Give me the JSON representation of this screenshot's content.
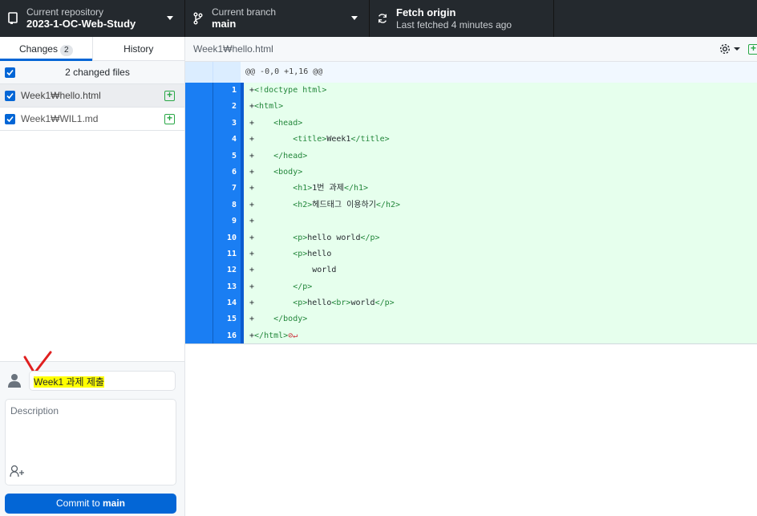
{
  "toolbar": {
    "repo": {
      "label": "Current repository",
      "value": "2023-1-OC-Web-Study"
    },
    "branch": {
      "label": "Current branch",
      "value": "main"
    },
    "fetch": {
      "label": "Fetch origin",
      "sub": "Last fetched 4 minutes ago"
    }
  },
  "sidebar": {
    "tabs": [
      {
        "label": "Changes",
        "count": "2"
      },
      {
        "label": "History"
      }
    ],
    "changed_files": "2 changed files",
    "files": [
      {
        "name": "Week1₩hello.html",
        "selected": true
      },
      {
        "name": "Week1₩WIL1.md",
        "selected": false
      }
    ]
  },
  "commit": {
    "summary": "Week1 과제 제출",
    "description_placeholder": "Description",
    "button_prefix": "Commit to ",
    "button_branch": "main"
  },
  "diff": {
    "file": "Week1₩hello.html",
    "hunk": "@@ -0,0 +1,16 @@",
    "lines": [
      "+<!doctype html>",
      "+<html>",
      "+    <head>",
      "+        <title>Week1</title>",
      "+    </head>",
      "+    <body>",
      "+        <h1>1번 과제</h1>",
      "+        <h2>헤드태그 이용하기</h2>",
      "+",
      "+        <p>hello world</p>",
      "+        <p>hello",
      "+            world",
      "+        </p>",
      "+        <p>hello<br>world</p>",
      "+    </body>",
      "+</html>"
    ]
  },
  "colors": {
    "accent": "#0366d6",
    "added_bg": "#e6ffed",
    "gutter": "#1a7ef3"
  }
}
